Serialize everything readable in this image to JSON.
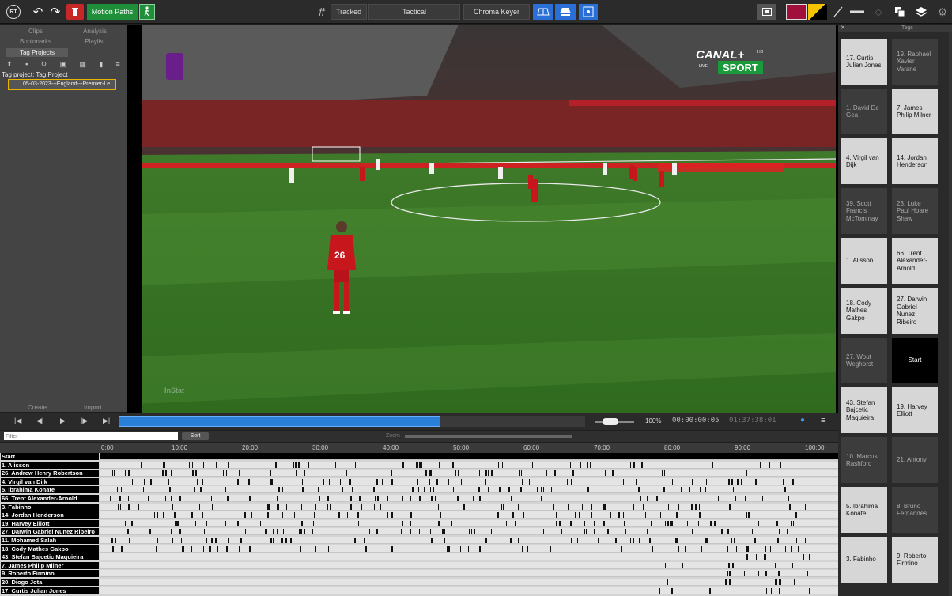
{
  "topbar": {
    "logo": "RT",
    "motion_paths": "Motion Paths",
    "tracked": "Tracked",
    "tactical": "Tactical",
    "chroma_keyer": "Chroma Keyer",
    "colors": {
      "accent_green": "#1f8f3a",
      "primary_swatch": "#a0103a",
      "blue": "#2a6fd6"
    }
  },
  "left_panel": {
    "tabs": [
      "Clips",
      "Analysis",
      "Bookmarks",
      "Playlist",
      "Tag Projects"
    ],
    "tag_project_label": "Tag project: Tag Project",
    "project_item": "05-03-2023---England---Premier-Le",
    "create": "Create",
    "import": "Import"
  },
  "video": {
    "channel_line1": "CANAL+",
    "channel_sup": "HD",
    "channel_live": "LIVE",
    "channel_line2": "SPORT",
    "watermark": "InStat",
    "jersey_number": "26"
  },
  "right_panel": {
    "header": "Tags",
    "tags": [
      {
        "label": "17. Curtis Julian Jones",
        "style": "light"
      },
      {
        "label": "19. Raphael Xavier Varane",
        "style": "dark"
      },
      {
        "label": "1. David De Gea",
        "style": "dark"
      },
      {
        "label": "7. James Philip Milner",
        "style": "light"
      },
      {
        "label": "4. Virgil van Dijk",
        "style": "light"
      },
      {
        "label": "14. Jordan Henderson",
        "style": "light"
      },
      {
        "label": "39. Scott Francis McTominay",
        "style": "dark"
      },
      {
        "label": "23. Luke Paul Hoare Shaw",
        "style": "dark"
      },
      {
        "label": "1. Alisson",
        "style": "light"
      },
      {
        "label": "66. Trent Alexander-Arnold",
        "style": "light"
      },
      {
        "label": "18. Cody Mathes Gakpo",
        "style": "light"
      },
      {
        "label": "27. Darwin Gabriel Nunez Ribeiro",
        "style": "light"
      },
      {
        "label": "27. Wout Weghorst",
        "style": "dark"
      },
      {
        "label": "Start",
        "style": "black"
      },
      {
        "label": "43. Stefan Bajcetic Maquieira",
        "style": "light"
      },
      {
        "label": "19. Harvey Elliott",
        "style": "light"
      },
      {
        "label": "10. Marcus Rashford",
        "style": "dark"
      },
      {
        "label": "21. Antony",
        "style": "dark"
      },
      {
        "label": "5. Ibrahima Konate",
        "style": "light"
      },
      {
        "label": "8. Bruno Fernandes",
        "style": "dark"
      },
      {
        "label": "3. Fabinho",
        "style": "light"
      },
      {
        "label": "9. Roberto Firmino",
        "style": "light"
      }
    ]
  },
  "controls": {
    "zoom_percent": "100%",
    "current_time": "00:00:00:05",
    "total_time": "01:37:38:01",
    "progress_fraction": 0.69
  },
  "filter": {
    "placeholder": "Filter",
    "sort": "Sort",
    "zoom_label": "Zoom"
  },
  "ruler": {
    "ticks": [
      "0:00",
      "10:00",
      "20:00",
      "30:00",
      "40:00",
      "50:00",
      "60:00",
      "70:00",
      "80:00",
      "90:00",
      "100:00"
    ]
  },
  "timeline": {
    "rows": [
      "Start",
      "1. Alisson",
      "26. Andrew Henry Robertson",
      "4. Virgil van Dijk",
      "5. Ibrahima Konate",
      "66. Trent Alexander-Arnold",
      "3. Fabinho",
      "14. Jordan Henderson",
      "19. Harvey Elliott",
      "27. Darwin Gabriel Nunez Ribeiro",
      "11. Mohamed Salah",
      "18. Cody Mathes Gakpo",
      "43. Stefan Bajcetic Maquieira",
      "7. James Philip Milner",
      "9. Roberto Firmino",
      "20. Diogo Jota",
      "17. Curtis Julian Jones"
    ]
  }
}
